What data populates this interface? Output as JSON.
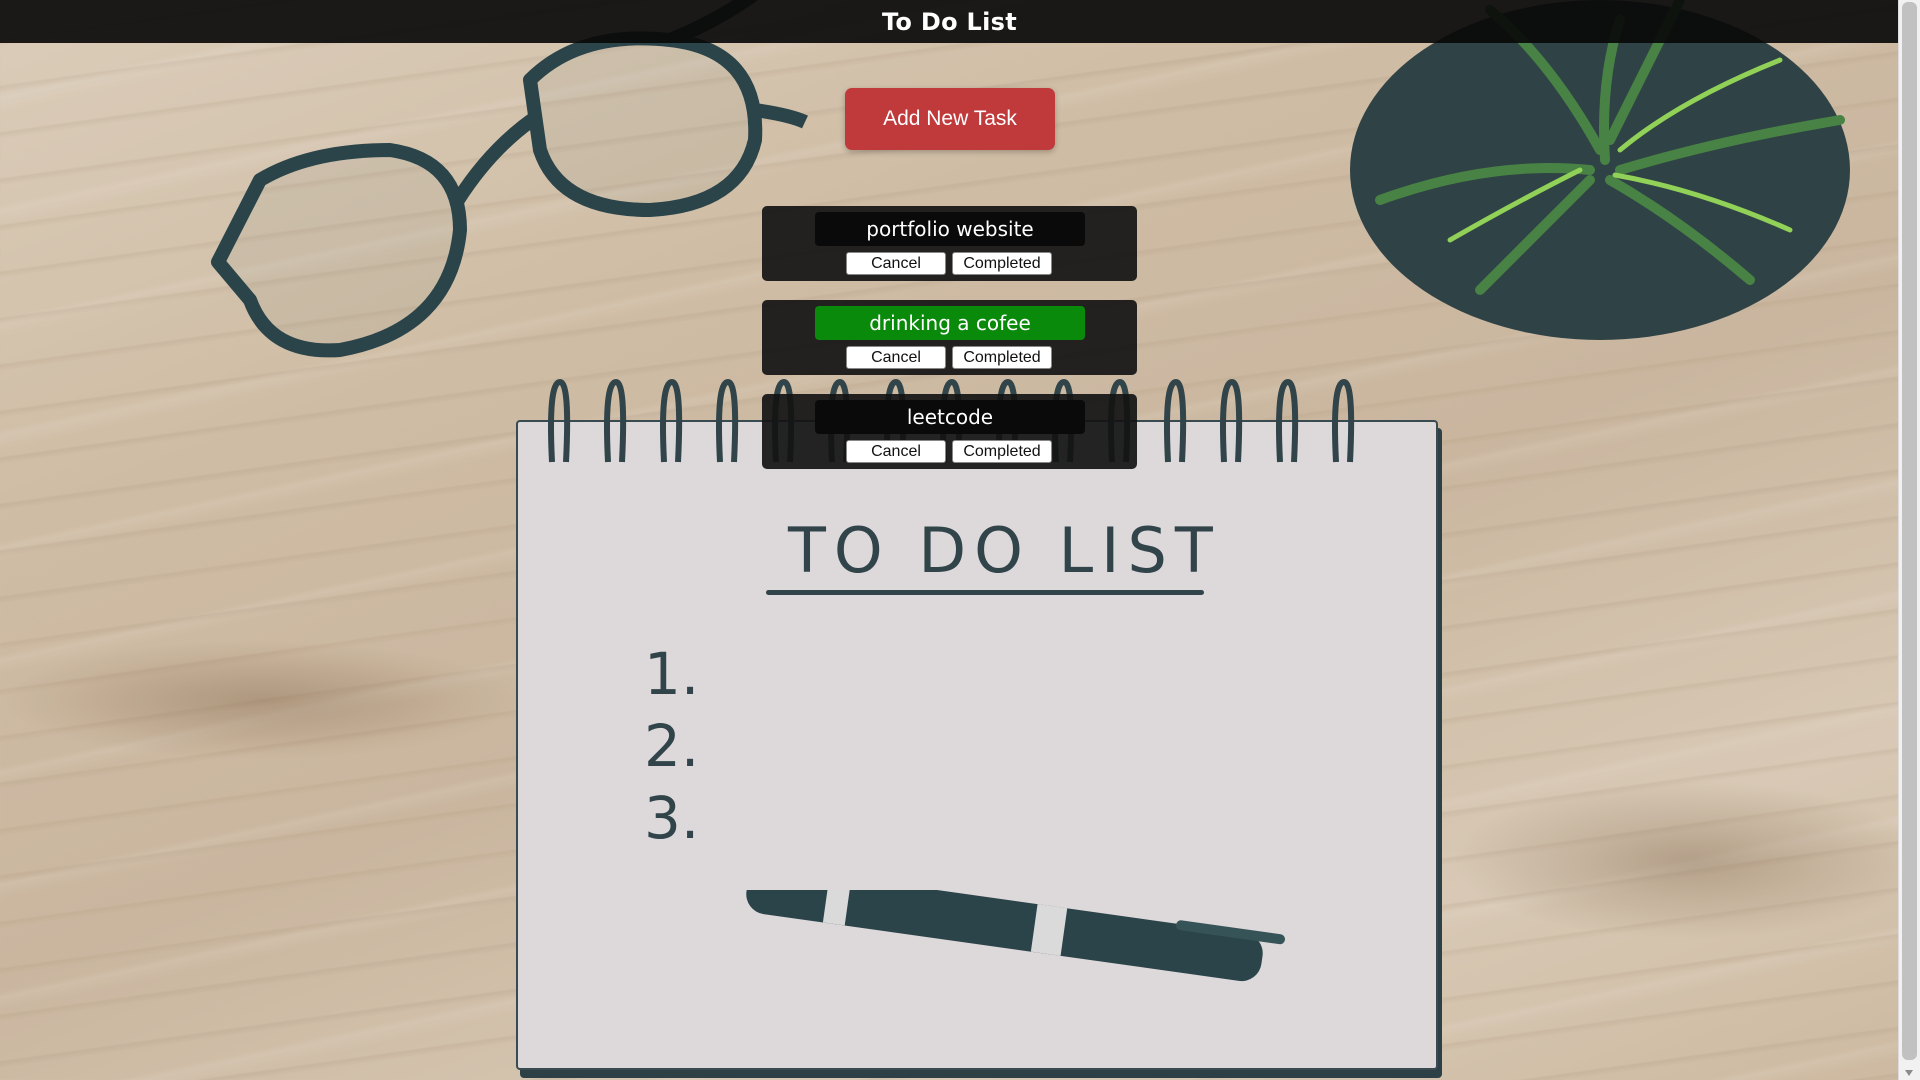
{
  "header": {
    "title": "To Do List"
  },
  "actions": {
    "add_task_label": "Add New Task"
  },
  "tasks": [
    {
      "name": "portfolio website",
      "completed": false,
      "cancel_label": "Cancel",
      "complete_label": "Completed"
    },
    {
      "name": "drinking a cofee",
      "completed": true,
      "cancel_label": "Cancel",
      "complete_label": "Completed"
    },
    {
      "name": "leetcode",
      "completed": false,
      "cancel_label": "Cancel",
      "complete_label": "Completed"
    }
  ],
  "background": {
    "notebook_title": "TO DO LIST",
    "notebook_numbers": [
      "1.",
      "2.",
      "3."
    ]
  },
  "colors": {
    "header_bg": "#0a0a0a",
    "add_button": "#c0393b",
    "completed_task": "#0a8a0a",
    "task_card": "#141414"
  }
}
